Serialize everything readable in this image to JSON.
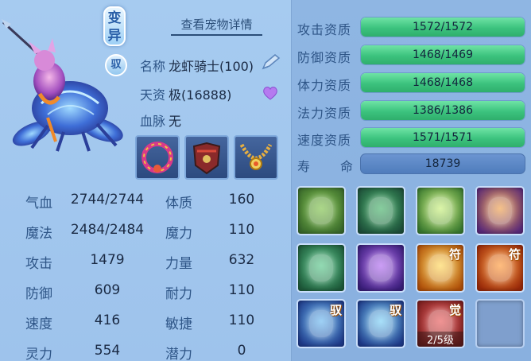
{
  "pet": {
    "variant_badge": [
      "变",
      "异"
    ],
    "ride_badge": "驭",
    "detail_link": "查看宠物详情",
    "name_label": "名称",
    "name_value": "龙虾骑士(100)",
    "aptitude_label": "天资",
    "aptitude_value": "极(16888)",
    "bloodline_label": "血脉",
    "bloodline_value": "无",
    "equipment": [
      "collar-ornament",
      "armor-ornament",
      "necklace-ornament"
    ]
  },
  "stats": [
    {
      "label": "气血",
      "value": "2744/2744",
      "attr_label": "体质",
      "attr_value": "160"
    },
    {
      "label": "魔法",
      "value": "2484/2484",
      "attr_label": "魔力",
      "attr_value": "110"
    },
    {
      "label": "攻击",
      "value": "1479",
      "attr_label": "力量",
      "attr_value": "632"
    },
    {
      "label": "防御",
      "value": "609",
      "attr_label": "耐力",
      "attr_value": "110"
    },
    {
      "label": "速度",
      "value": "416",
      "attr_label": "敏捷",
      "attr_value": "110"
    },
    {
      "label": "灵力",
      "value": "554",
      "attr_label": "潜力",
      "attr_value": "0"
    }
  ],
  "aptitudes": [
    {
      "label": "攻击资质",
      "text": "1572/1572",
      "current": 1572,
      "max": 1572
    },
    {
      "label": "防御资质",
      "text": "1468/1469",
      "current": 1468,
      "max": 1469
    },
    {
      "label": "体力资质",
      "text": "1468/1468",
      "current": 1468,
      "max": 1468
    },
    {
      "label": "法力资质",
      "text": "1386/1386",
      "current": 1386,
      "max": 1386
    },
    {
      "label": "速度资质",
      "text": "1571/1571",
      "current": 1571,
      "max": 1571
    }
  ],
  "lifespan": {
    "label_a": "寿",
    "label_b": "命",
    "value": "18739"
  },
  "skills": [
    {
      "icon": "boot-icon",
      "tag": "",
      "level": "",
      "colors": [
        "#3a6a2c",
        "#7fc24a"
      ]
    },
    {
      "icon": "green-giant-icon",
      "tag": "",
      "level": "",
      "colors": [
        "#1e4f3a",
        "#46b36a"
      ]
    },
    {
      "icon": "heart-aura-icon",
      "tag": "",
      "level": "",
      "colors": [
        "#3a7a30",
        "#c9f07a"
      ]
    },
    {
      "icon": "rune-strike-icon",
      "tag": "",
      "level": "",
      "colors": [
        "#5a2a7a",
        "#f0a04a"
      ]
    },
    {
      "icon": "shield-swirl-icon",
      "tag": "",
      "level": "",
      "colors": [
        "#1e5a3a",
        "#58c78a"
      ]
    },
    {
      "icon": "purple-burst-icon",
      "tag": "",
      "level": "",
      "colors": [
        "#3a1e7a",
        "#b06af0"
      ]
    },
    {
      "icon": "golden-wings-icon",
      "tag": "符",
      "level": "",
      "colors": [
        "#b0500a",
        "#ffd85a"
      ]
    },
    {
      "icon": "flame-scroll-icon",
      "tag": "符",
      "level": "",
      "colors": [
        "#9a2a0a",
        "#ff9a3a"
      ]
    },
    {
      "icon": "ice-claw-icon",
      "tag": "驭",
      "level": "",
      "colors": [
        "#1e3a8a",
        "#6ab8f0"
      ]
    },
    {
      "icon": "blue-slash-icon",
      "tag": "驭",
      "level": "",
      "colors": [
        "#1e3a8a",
        "#7ad0f7"
      ]
    },
    {
      "icon": "red-fist-icon",
      "tag": "觉",
      "level": "2/5级",
      "colors": [
        "#7a1e1e",
        "#e85a5a"
      ]
    },
    {
      "icon": "empty-slot",
      "tag": "",
      "level": "",
      "colors": [
        "#7f9fcd",
        "#7f9fcd"
      ]
    }
  ]
}
